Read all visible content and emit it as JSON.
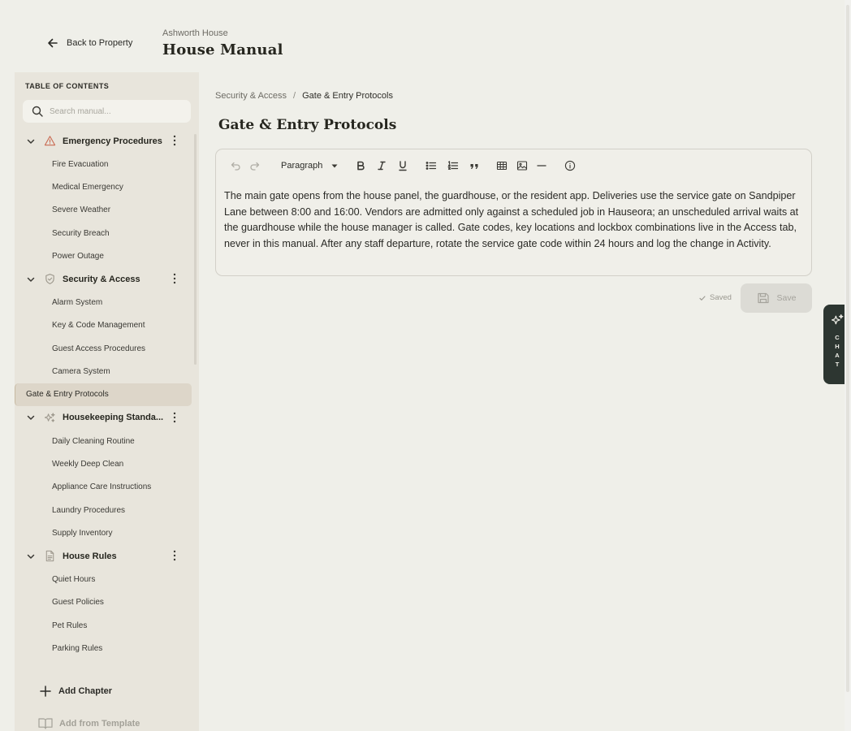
{
  "header": {
    "back_label": "Back to Property",
    "property_name": "Ashworth House",
    "title": "House Manual"
  },
  "sidebar": {
    "heading": "TABLE OF CONTENTS",
    "search_placeholder": "Search manual...",
    "chapters": [
      {
        "label": "Emergency Procedures",
        "icon": "warning-triangle-icon",
        "sections": [
          "Fire Evacuation",
          "Medical Emergency",
          "Severe Weather",
          "Security Breach",
          "Power Outage"
        ]
      },
      {
        "label": "Security & Access",
        "icon": "shield-check-icon",
        "sections": [
          "Alarm System",
          "Key & Code Management",
          "Guest Access Procedures",
          "Camera System",
          "Gate & Entry Protocols"
        ]
      },
      {
        "label": "Housekeeping Standa...",
        "icon": "sparkles-icon",
        "sections": [
          "Daily Cleaning Routine",
          "Weekly Deep Clean",
          "Appliance Care Instructions",
          "Laundry Procedures",
          "Supply Inventory"
        ]
      },
      {
        "label": "House Rules",
        "icon": "document-icon",
        "sections": [
          "Quiet Hours",
          "Guest Policies",
          "Pet Rules",
          "Parking Rules"
        ]
      }
    ],
    "active_section": "Gate & Entry Protocols",
    "add_chapter_label": "Add Chapter",
    "add_template_label": "Add from Template"
  },
  "main": {
    "breadcrumb": {
      "parent": "Security & Access",
      "separator": "/",
      "current": "Gate & Entry Protocols"
    },
    "title": "Gate & Entry Protocols",
    "toolbar": {
      "block_type": "Paragraph"
    },
    "body": "The main gate opens from the house panel, the guardhouse, or the resident app. Deliveries use the service gate on Sandpiper Lane between 8:00 and 16:00. Vendors are admitted only against a scheduled job in Hauseora; an unscheduled arrival waits at the guardhouse while the house manager is called. Gate codes, key locations and lockbox combinations live in the Access tab, never in this manual. After any staff departure, rotate the service gate code within 24 hours and log the change in Activity.",
    "saved_status": "Saved",
    "save_label": "Save"
  },
  "chat": {
    "letters": [
      "C",
      "H",
      "A",
      "T"
    ]
  },
  "colors": {
    "background": "#efefe9",
    "sidebar": "#e8e5dc",
    "active_item": "#ddd6c9",
    "chat_tab": "#2d3631",
    "warning_icon": "#c96a52"
  }
}
